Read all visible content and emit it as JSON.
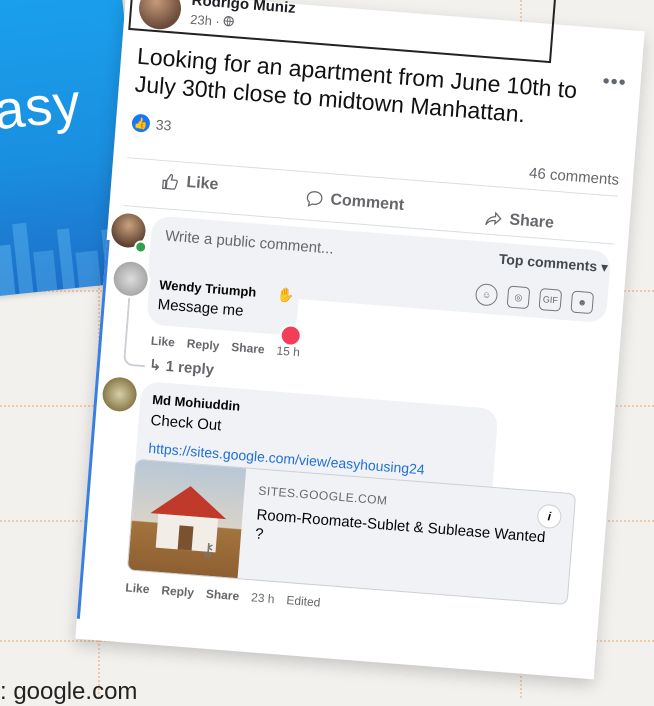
{
  "brand": {
    "text": "asy"
  },
  "post": {
    "author": "Rodrigo Muniz",
    "meta": "23h · ",
    "text": "Looking for an apartment from June 10th to July 30th close to midtown Manhattan.",
    "like_count": "33",
    "comments_count": "46 comments"
  },
  "actions": {
    "like": "Like",
    "comment": "Comment",
    "share": "Share"
  },
  "compose": {
    "placeholder": "Write a public comment...",
    "sort": "Top comments"
  },
  "comments": [
    {
      "name": "Wendy Triumph",
      "text": "Message me",
      "actions": [
        "Like",
        "Reply",
        "Share"
      ],
      "time": "15 h",
      "replies": "1 reply"
    },
    {
      "name": "Md Mohiuddin",
      "text": "Check Out",
      "link": "https://sites.google.com/view/easyhousing24",
      "preview": {
        "domain": "SITES.GOOGLE.COM",
        "title": "Room-Roomate-Sublet & Sublease Wanted ?"
      },
      "actions": [
        "Like",
        "Reply",
        "Share"
      ],
      "time": "23 h",
      "edited": "Edited"
    }
  ],
  "caption": ": google.com"
}
